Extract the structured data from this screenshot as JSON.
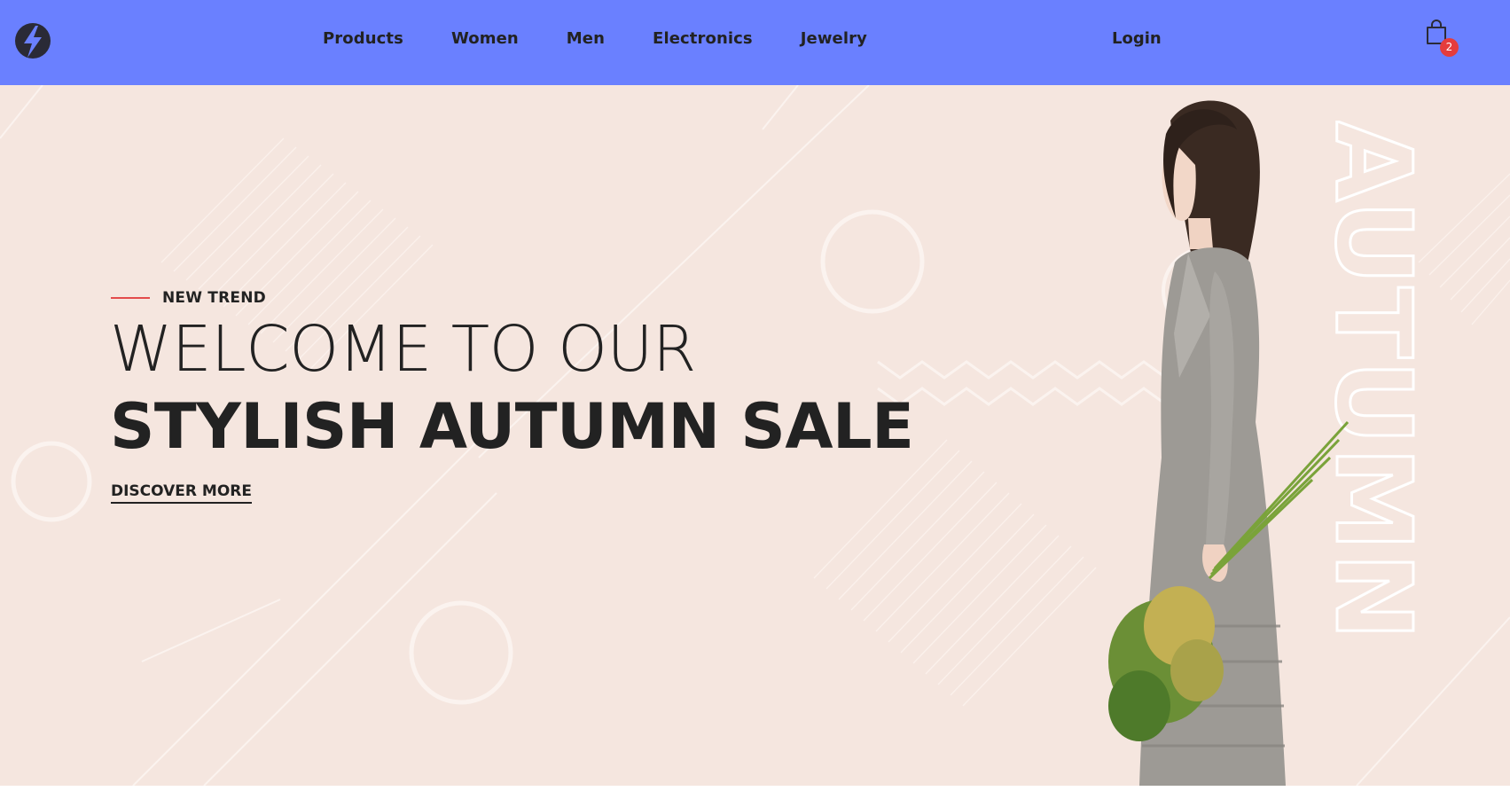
{
  "nav": {
    "items": [
      {
        "label": "Products"
      },
      {
        "label": "Women"
      },
      {
        "label": "Men"
      },
      {
        "label": "Electronics"
      },
      {
        "label": "Jewelry"
      }
    ],
    "login_label": "Login",
    "cart_count": "2"
  },
  "hero": {
    "kicker": "NEW TREND",
    "headline_line1": "WELCOME TO OUR",
    "headline_line2": "STYLISH AUTUMN SALE",
    "cta_label": "DISCOVER MORE",
    "vertical_word": "AUTUMN"
  },
  "colors": {
    "navbar_bg": "#6a80ff",
    "hero_bg": "#f5e6df",
    "accent_red": "#e34b4b",
    "badge_red": "#e53c3c",
    "text_dark": "#222222"
  },
  "icons": {
    "logo": "lightning-bolt-logo-icon",
    "cart": "shopping-bag-icon"
  }
}
